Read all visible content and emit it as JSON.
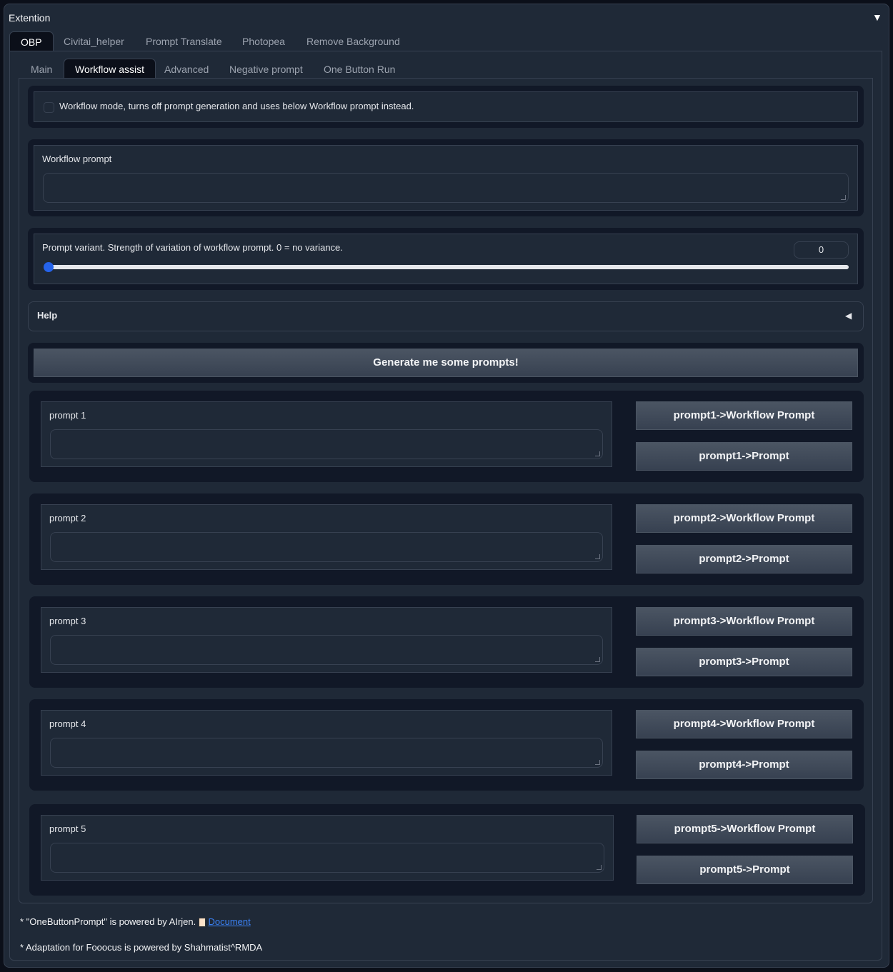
{
  "panel": {
    "title": "Extention",
    "collapse_icon": "triangle-down"
  },
  "tabs": [
    "OBP",
    "Civitai_helper",
    "Prompt Translate",
    "Photopea",
    "Remove Background"
  ],
  "subtabs": [
    "Main",
    "Workflow assist",
    "Advanced",
    "Negative prompt",
    "One Button Run"
  ],
  "workflow_mode": {
    "label": "Workflow mode, turns off prompt generation and uses below Workflow prompt instead.",
    "checked": false
  },
  "workflow_prompt": {
    "label": "Workflow prompt",
    "value": ""
  },
  "variant": {
    "label": "Prompt variant. Strength of variation of workflow prompt. 0 = no variance.",
    "value": "0",
    "fraction": 0
  },
  "help": {
    "label": "Help"
  },
  "generate_label": "Generate me some prompts!",
  "prompts": [
    {
      "label": "prompt 1",
      "value": "",
      "wf_button": "prompt1->Workflow Prompt",
      "p_button": "prompt1->Prompt"
    },
    {
      "label": "prompt 2",
      "value": "",
      "wf_button": "prompt2->Workflow Prompt",
      "p_button": "prompt2->Prompt"
    },
    {
      "label": "prompt 3",
      "value": "",
      "wf_button": "prompt3->Workflow Prompt",
      "p_button": "prompt3->Prompt"
    },
    {
      "label": "prompt 4",
      "value": "",
      "wf_button": "prompt4->Workflow Prompt",
      "p_button": "prompt4->Prompt"
    },
    {
      "label": "prompt 5",
      "value": "",
      "wf_button": "prompt5->Workflow Prompt",
      "p_button": "prompt5->Prompt"
    }
  ],
  "footer": {
    "line1": "* \"OneButtonPrompt\" is powered by AIrjen.",
    "link": "Document",
    "line2": "* Adaptation for Fooocus is powered by Shahmatist^RMDA"
  }
}
